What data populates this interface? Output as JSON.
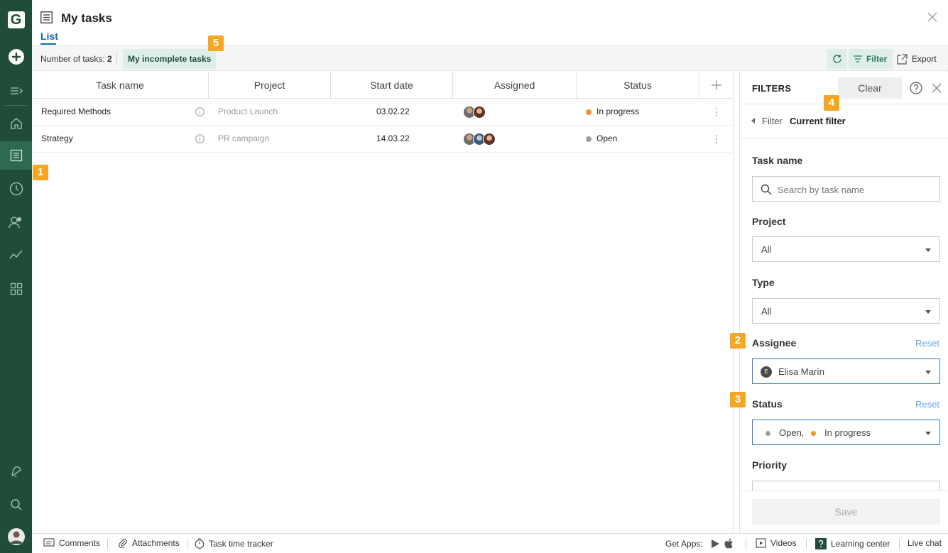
{
  "app": {
    "logo_letter": "G"
  },
  "header": {
    "title": "My tasks",
    "tab": "List"
  },
  "toolbar": {
    "num_tasks_label": "Number of tasks:",
    "num_tasks_value": "2",
    "incomplete_label": "My incomplete tasks",
    "filter_label": "Filter",
    "export_label": "Export"
  },
  "table": {
    "columns": [
      "Task name",
      "Project",
      "Start date",
      "Assigned",
      "Status"
    ],
    "rows": [
      {
        "name": "Required Methods",
        "project": "Product Launch",
        "start": "03.02.22",
        "status": "In progress",
        "status_color": "#f0932b"
      },
      {
        "name": "Strategy",
        "project": "PR campaign",
        "start": "14.03.22",
        "status": "Open",
        "status_color": "#9e9e9e"
      }
    ]
  },
  "filters": {
    "title": "FILTERS",
    "clear_label": "Clear",
    "crumb_parent": "Filter",
    "crumb_current": "Current filter",
    "task_name_label": "Task name",
    "task_name_placeholder": "Search by task name",
    "project_label": "Project",
    "project_value": "All",
    "type_label": "Type",
    "type_value": "All",
    "assignee_label": "Assignee",
    "assignee_value": "Elisa Marín",
    "assignee_initial": "E",
    "reset_label": "Reset",
    "status_label": "Status",
    "status_values": [
      "Open,",
      "In progress"
    ],
    "priority_label": "Priority",
    "save_label": "Save"
  },
  "badges": [
    "1",
    "2",
    "3",
    "4",
    "5"
  ],
  "footer": {
    "comments": "Comments",
    "attachments": "Attachments",
    "tracker": "Task time tracker",
    "get_apps": "Get Apps:",
    "videos": "Videos",
    "learning": "Learning center",
    "chat": "Live chat"
  },
  "colors": {
    "sidebar": "#1f4d3a",
    "accent": "#1565c0",
    "badge": "#f5a623"
  }
}
